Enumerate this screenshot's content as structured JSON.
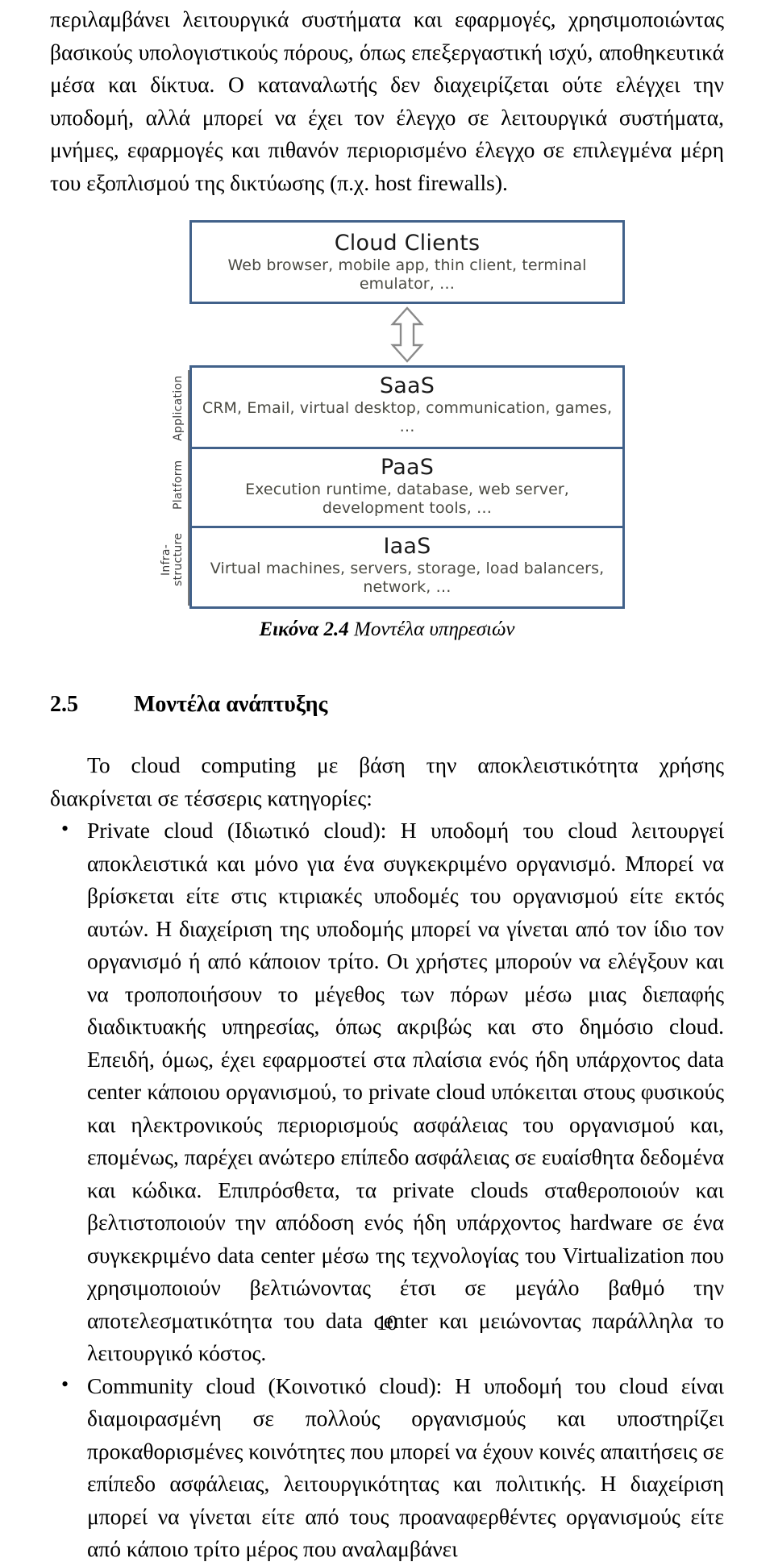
{
  "document": {
    "page_number": "10"
  },
  "intro_paragraph": {
    "text": "περιλαμβάνει λειτουργικά συστήματα και εφαρμογές, χρησιμοποιώντας βασικούς υπολογιστικούς πόρους, όπως επεξεργαστική ισχύ, αποθηκευτικά μέσα και δίκτυα. Ο καταναλωτής δεν διαχειρίζεται ούτε ελέγχει την υποδομή, αλλά μπορεί να έχει τον έλεγχο σε λειτουργικά συστήματα, μνήμες, εφαρμογές και πιθανόν περιορισμένο έλεγχο σε επιλεγμένα μέρη του εξοπλισμού της δικτύωσης (π.χ. host firewalls)."
  },
  "figure": {
    "caption_label": "Εικόνα 2.4",
    "caption_text": " Μοντέλα υπηρεσιών",
    "border_color": "#41618a",
    "axis_rule_color": "#7b7b7b",
    "axis_labels": {
      "application": "Application",
      "platform": "Platform",
      "infrastructure_line1": "Infra-",
      "infrastructure_line2": "structure"
    },
    "arrow_icon": "double-headed-vertical-arrow",
    "layers": [
      {
        "id": "cloud-clients",
        "title": "Cloud Clients",
        "subtitle": "Web browser, mobile app, thin client, terminal emulator, …"
      },
      {
        "id": "saas",
        "title": "SaaS",
        "subtitle": "CRM, Email, virtual desktop, communication, games, …"
      },
      {
        "id": "paas",
        "title": "PaaS",
        "subtitle": "Execution runtime, database, web server, development tools, …"
      },
      {
        "id": "iaas",
        "title": "IaaS",
        "subtitle": "Virtual machines, servers, storage, load balancers, network, …"
      }
    ]
  },
  "section": {
    "number": "2.5",
    "title": "Μοντέλα ανάπτυξης",
    "lead_paragraph": "Το cloud computing με βάση την αποκλειστικότητα χρήσης διακρίνεται σε τέσσερις κατηγορίες:",
    "bullets": [
      {
        "id": "private-cloud",
        "text": "Private cloud (Ιδιωτικό cloud): Η υποδομή του cloud λειτουργεί αποκλειστικά και μόνο για ένα συγκεκριμένο οργανισμό. Μπορεί να βρίσκεται είτε στις κτιριακές υποδομές του οργανισμού είτε εκτός αυτών. Η διαχείριση της υποδομής μπορεί να γίνεται από τον ίδιο τον οργανισμό ή από κάποιον τρίτο. Οι χρήστες μπορούν να ελέγξουν και να τροποποιήσουν το μέγεθος των πόρων μέσω μιας διεπαφής διαδικτυακής υπηρεσίας, όπως ακριβώς και στο δημόσιο cloud. Επειδή, όμως, έχει εφαρμοστεί στα πλαίσια ενός ήδη υπάρχοντος data center κάποιου οργανισμού, το private cloud υπόκειται στους φυσικούς και ηλεκτρονικούς περιορισμούς ασφάλειας του οργανισμού και, επομένως, παρέχει ανώτερο επίπεδο ασφάλειας σε ευαίσθητα δεδομένα και κώδικα. Επιπρόσθετα, τα private clouds σταθεροποιούν και βελτιστοποιούν την απόδοση ενός ήδη υπάρχοντος hardware σε ένα συγκεκριμένο data center μέσω της τεχνολογίας του Virtualization που χρησιμοποιούν βελτιώνοντας έτσι σε μεγάλο βαθμό την αποτελεσματικότητα του data center και μειώνοντας παράλληλα το λειτουργικό κόστος."
      },
      {
        "id": "community-cloud",
        "text": "Community cloud (Κοινοτικό cloud): Η υποδομή του cloud είναι διαμοιρασμένη σε πολλούς οργανισμούς και υποστηρίζει προκαθορισμένες κοινότητες που μπορεί να έχουν κοινές απαιτήσεις σε επίπεδο ασφάλειας, λειτουργικότητας και πολιτικής. Η διαχείριση μπορεί να γίνεται είτε από τους προαναφερθέντες οργανισμούς είτε από κάποιο τρίτο μέρος που αναλαμβάνει"
      }
    ]
  }
}
